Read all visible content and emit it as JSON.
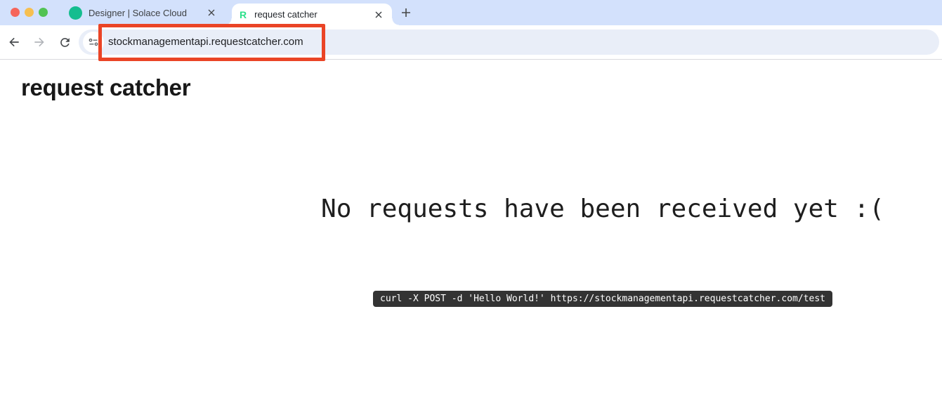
{
  "window": {
    "controls": [
      {
        "name": "close",
        "color": "#f5655b"
      },
      {
        "name": "minimize",
        "color": "#f6bf50"
      },
      {
        "name": "maximize",
        "color": "#52c353"
      }
    ]
  },
  "tab_strip": {
    "tabs": [
      {
        "title": "Designer | Solace Cloud",
        "favicon": "green-circle",
        "favicon_color": "#15bd8f",
        "active": false
      },
      {
        "title": "request catcher",
        "favicon": "letter-R",
        "favicon_letter": "R",
        "favicon_color": "#2ce08a",
        "active": true
      }
    ],
    "new_tab_label": "+"
  },
  "toolbar": {
    "url": "stockmanagementapi.requestcatcher.com",
    "icons": [
      "back",
      "forward",
      "reload",
      "site-settings"
    ]
  },
  "annotation": {
    "type": "highlight-box",
    "color": "#ea4426"
  },
  "page": {
    "heading": "request catcher",
    "empty_message": "No requests have been received yet :(",
    "curl_command": "curl -X POST -d 'Hello World!' https://stockmanagementapi.requestcatcher.com/test",
    "curl_badge_bg": "#333333"
  }
}
